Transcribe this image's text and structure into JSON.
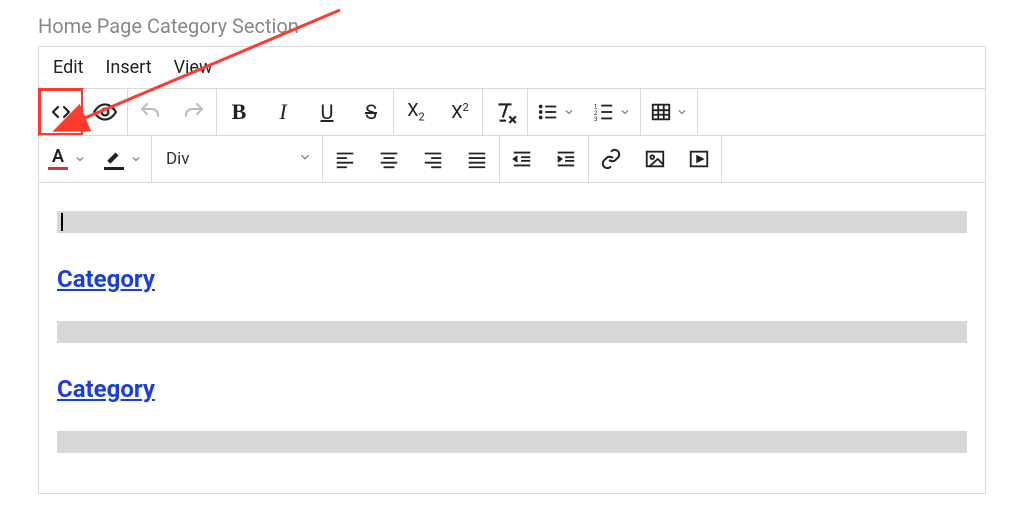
{
  "page_title": "Home Page Category Section",
  "menubar": {
    "edit": "Edit",
    "insert": "Insert",
    "view": "View"
  },
  "block_select": {
    "value": "Div"
  },
  "content": {
    "link1": "Category",
    "link2": "Category"
  },
  "colors": {
    "highlight": "#ff3b30",
    "link": "#1a3fd6"
  }
}
